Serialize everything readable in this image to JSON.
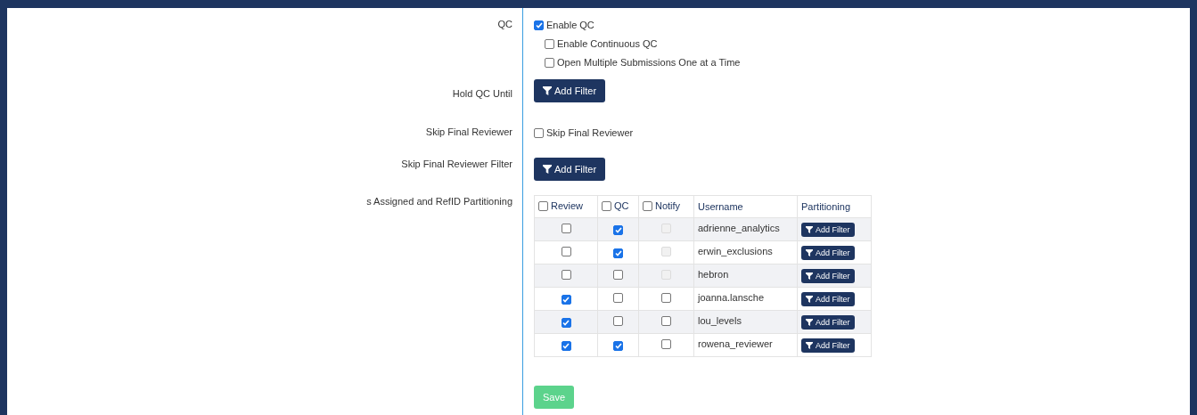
{
  "sections": [
    {
      "label": "QC",
      "kind": "checkboxes",
      "options": [
        {
          "label": "Enable QC",
          "checked": true,
          "children": [
            {
              "label": "Enable Continuous QC",
              "checked": false
            },
            {
              "label": "Open Multiple Submissions One at a Time",
              "checked": false
            }
          ]
        }
      ]
    },
    {
      "label": "Hold QC Until",
      "kind": "filter",
      "button": "Add Filter"
    },
    {
      "label": "Skip Final Reviewer",
      "kind": "checkboxes",
      "options": [
        {
          "label": "Skip Final Reviewer",
          "checked": false
        }
      ]
    },
    {
      "label": "Skip Final Reviewer Filter",
      "kind": "filter",
      "button": "Add Filter"
    },
    {
      "label": "s Assigned and RefID Partitioning",
      "kind": "table",
      "table": {
        "columns": [
          {
            "label": "Review",
            "checkbox": true,
            "checked": false
          },
          {
            "label": "QC",
            "checkbox": true,
            "checked": false
          },
          {
            "label": "Notify",
            "checkbox": true,
            "checked": false
          },
          {
            "label": "Username",
            "checkbox": false
          },
          {
            "label": "Partitioning",
            "checkbox": false
          }
        ],
        "rows": [
          {
            "review": false,
            "qc": true,
            "notify": false,
            "notify_disabled": true,
            "username": "adrienne_analytics",
            "button": "Add Filter"
          },
          {
            "review": false,
            "qc": true,
            "notify": false,
            "notify_disabled": true,
            "username": "erwin_exclusions",
            "button": "Add Filter"
          },
          {
            "review": false,
            "qc": false,
            "notify": false,
            "notify_disabled": true,
            "username": "hebron",
            "button": "Add Filter"
          },
          {
            "review": true,
            "qc": false,
            "notify": false,
            "notify_disabled": false,
            "username": "joanna.lansche",
            "button": "Add Filter"
          },
          {
            "review": true,
            "qc": false,
            "notify": false,
            "notify_disabled": false,
            "username": "lou_levels",
            "button": "Add Filter"
          },
          {
            "review": true,
            "qc": true,
            "notify": false,
            "notify_disabled": false,
            "username": "rowena_reviewer",
            "button": "Add Filter"
          }
        ]
      }
    }
  ],
  "save_button": "Save"
}
